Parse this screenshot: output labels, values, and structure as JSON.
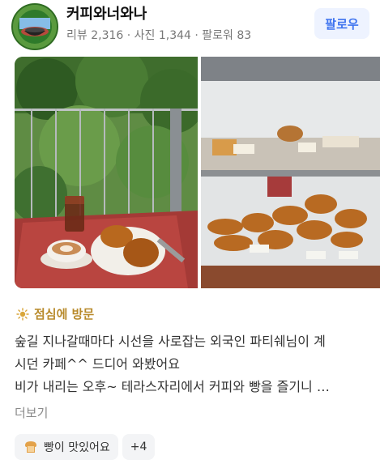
{
  "profile": {
    "username": "커피와너와나",
    "stats": "리뷰 2,316 · 사진 1,344 · 팔로워 83",
    "follow_label": "팔로우"
  },
  "visit_tag": {
    "icon": "sun-icon",
    "label": "점심에 방문"
  },
  "review": {
    "lines": [
      "숲길 지나갈때마다 시선을 사로잡는 외국인 파티쉐님이 계",
      "시던 카페^^ 드디어 와봤어요",
      "비가 내리는 오후~ 테라스자리에서 커피와 빵을 즐기니 …"
    ],
    "more_label": "더보기"
  },
  "keywords": {
    "items": [
      {
        "icon": "bread-icon",
        "label": "빵이 맛있어요"
      }
    ],
    "extra_count": "+4"
  },
  "colors": {
    "accent": "#3f74ef",
    "tag": "#b88a2b"
  }
}
